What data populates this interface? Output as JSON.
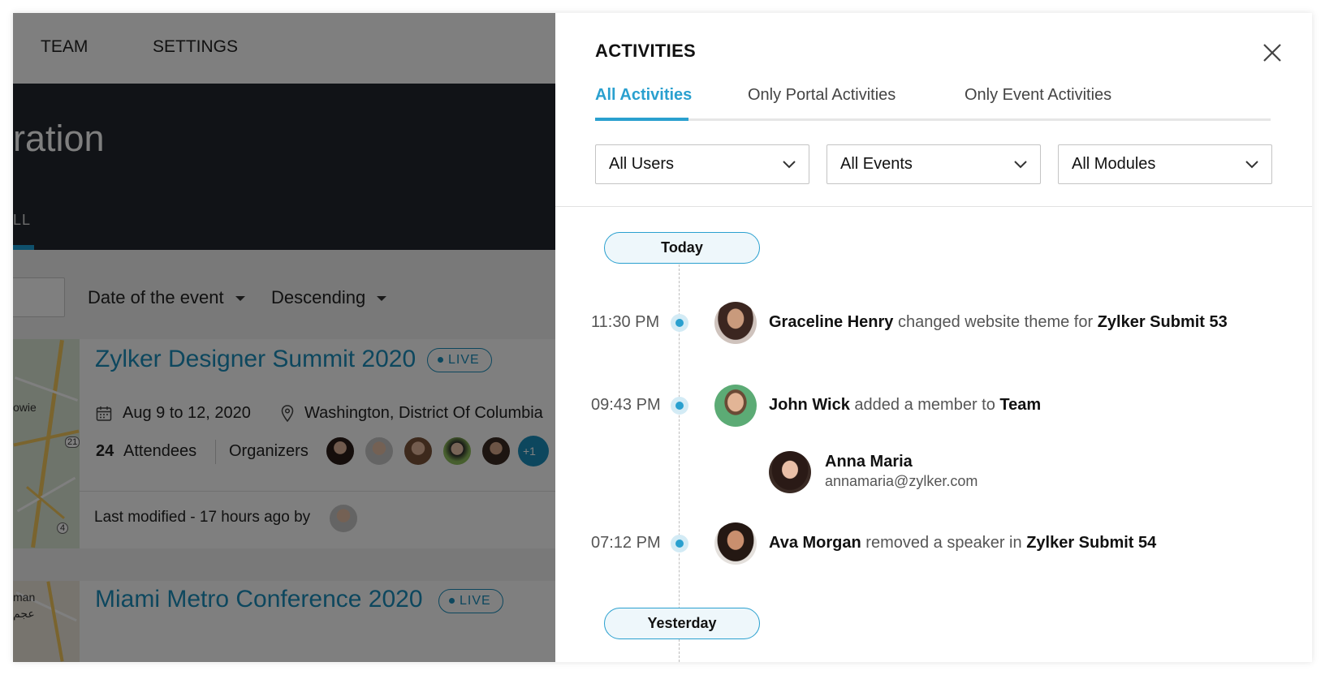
{
  "background_page": {
    "nav": {
      "team": "TEAM",
      "settings": "SETTINGS"
    },
    "hero": {
      "title_fragment": "ration",
      "tab_fragment": "LL"
    },
    "sort": {
      "field": "Date of the event",
      "order": "Descending"
    },
    "events": [
      {
        "title": "Zylker Designer Summit 2020",
        "status": "LIVE",
        "dates": "Aug 9 to 12, 2020",
        "location": "Washington, District Of Columbia",
        "attendee_count": "24",
        "attendees_label": "Attendees",
        "organizers_label": "Organizers",
        "more_organizers": "+1",
        "last_modified": "Last modified - 17 hours ago by",
        "map_labels": [
          "owie",
          "21",
          "4"
        ]
      },
      {
        "title": "Miami Metro Conference 2020",
        "status": "LIVE",
        "map_labels": [
          "man",
          "عجم"
        ]
      }
    ]
  },
  "panel": {
    "title": "ACTIVITIES",
    "tabs": [
      {
        "label": "All Activities",
        "active": true
      },
      {
        "label": "Only Portal Activities",
        "active": false
      },
      {
        "label": "Only Event Activities",
        "active": false
      }
    ],
    "filters": {
      "users": "All Users",
      "events": "All Events",
      "modules": "All Modules"
    },
    "days": {
      "today": "Today",
      "yesterday": "Yesterday"
    },
    "activities": [
      {
        "time": "11:30 PM",
        "actor": "Graceline Henry",
        "action": "changed website theme for",
        "target": "Zylker Submit 53"
      },
      {
        "time": "09:43 PM",
        "actor": "John Wick",
        "action": "added a member to",
        "target": "Team",
        "member": {
          "name": "Anna Maria",
          "email": "annamaria@zylker.com"
        }
      },
      {
        "time": "07:12 PM",
        "actor": "Ava Morgan",
        "action": "removed a speaker in",
        "target": "Zylker Submit 54"
      }
    ]
  },
  "colors": {
    "accent": "#2aa0cf",
    "link": "#1a8fbd",
    "hero": "#22262f"
  }
}
